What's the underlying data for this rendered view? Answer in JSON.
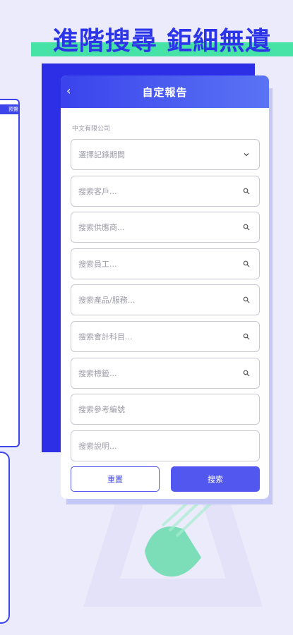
{
  "headline": "進階搜尋  鉅細無遺",
  "left_phone_tab": "預覽",
  "screen": {
    "title": "自定報告",
    "company": "中文有限公司",
    "fields": [
      {
        "placeholder": "選擇記錄期間",
        "icon": "chevron-down-icon"
      },
      {
        "placeholder": "搜索客戶...",
        "icon": "search-icon"
      },
      {
        "placeholder": "搜索供應商...",
        "icon": "search-icon"
      },
      {
        "placeholder": "搜索員工...",
        "icon": "search-icon"
      },
      {
        "placeholder": "搜索產品/服務...",
        "icon": "search-icon"
      },
      {
        "placeholder": "搜索會計科目...",
        "icon": "search-icon"
      },
      {
        "placeholder": "搜索標籤...",
        "icon": "search-icon"
      },
      {
        "placeholder": "搜索參考編號",
        "icon": ""
      },
      {
        "placeholder": "搜索說明...",
        "icon": ""
      }
    ],
    "reset_label": "重置",
    "search_label": "搜索"
  },
  "colors": {
    "background": "#ECEBFB",
    "brand_blue": "#2D35E8",
    "accent_green": "#46E2A6",
    "button_blue": "#5157EF"
  }
}
